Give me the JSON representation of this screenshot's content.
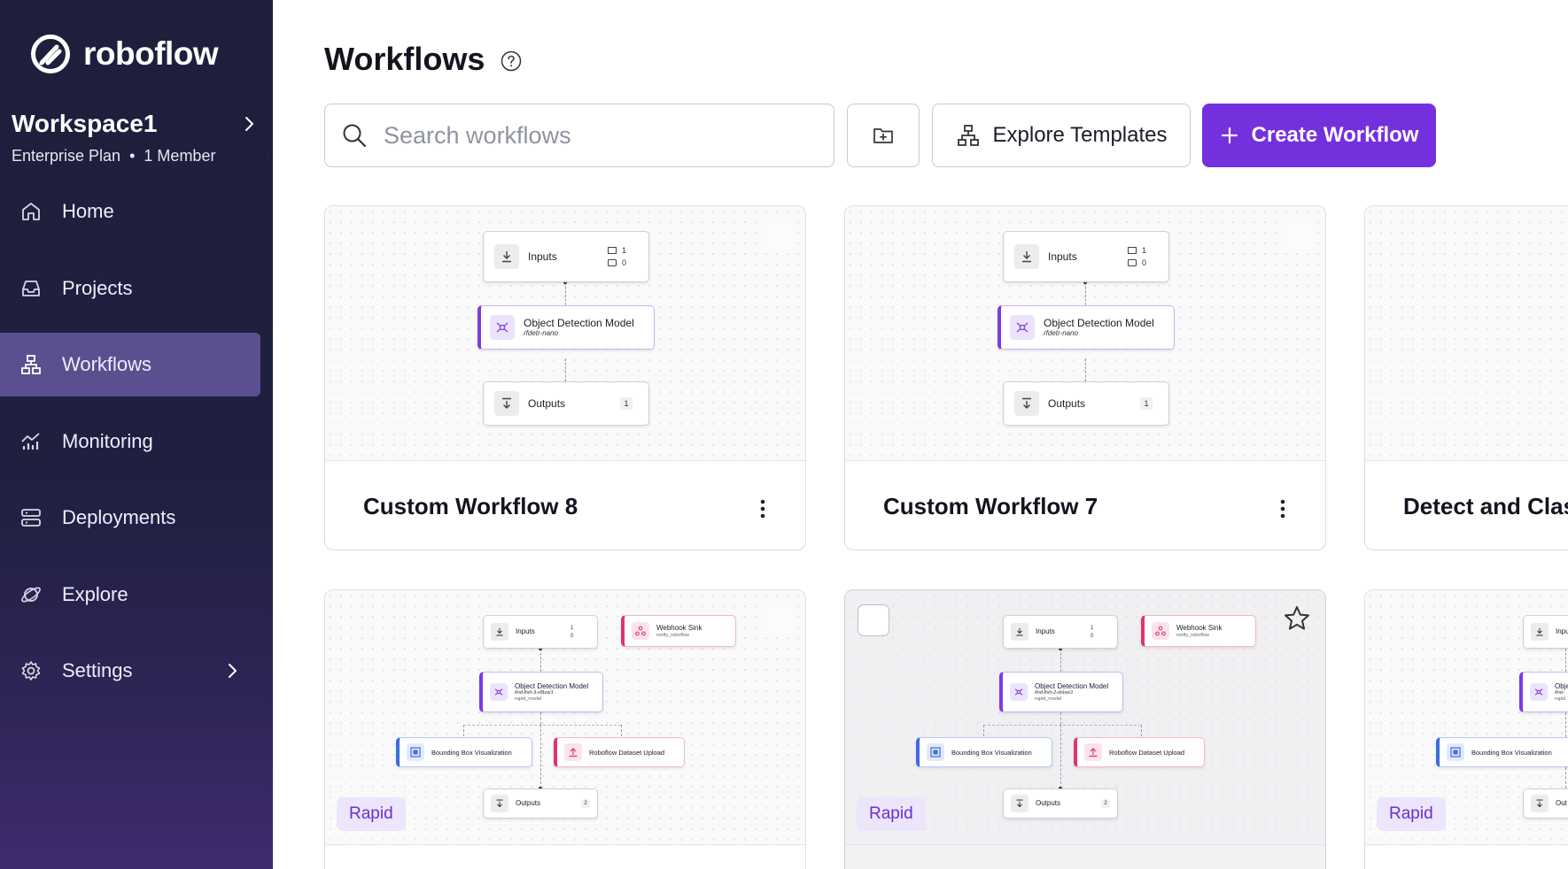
{
  "brand": {
    "name": "roboflow"
  },
  "workspace": {
    "name": "Workspace1",
    "plan": "Enterprise Plan",
    "separator": "•",
    "members": "1 Member"
  },
  "nav": [
    {
      "label": "Home",
      "icon": "home-icon"
    },
    {
      "label": "Projects",
      "icon": "inbox-icon"
    },
    {
      "label": "Workflows",
      "icon": "workflow-icon",
      "active": true
    },
    {
      "label": "Monitoring",
      "icon": "monitoring-icon"
    },
    {
      "label": "Deployments",
      "icon": "server-icon"
    },
    {
      "label": "Explore",
      "icon": "planet-icon"
    },
    {
      "label": "Settings",
      "icon": "gear-icon",
      "has_submenu": true
    }
  ],
  "page": {
    "title": "Workflows"
  },
  "search": {
    "placeholder": "Search workflows",
    "value": ""
  },
  "toolbar": {
    "explore_label": "Explore Templates",
    "create_label": "Create Workflow"
  },
  "colors": {
    "accent": "#7530de",
    "sidebar_bg": "#1e1f3b",
    "active_nav": "#5b4f8f"
  },
  "cards_row1": [
    {
      "title": "Custom Workflow 8",
      "nodes": {
        "inputs": "Inputs",
        "inputs_images": "1",
        "inputs_params": "0",
        "model": "Object Detection Model",
        "model_id": "rfdetr-nano",
        "outputs": "Outputs",
        "outputs_count": "1"
      }
    },
    {
      "title": "Custom Workflow 7",
      "nodes": {
        "inputs": "Inputs",
        "inputs_images": "1",
        "inputs_params": "0",
        "model": "Object Detection Model",
        "model_id": "rfdetr-nano",
        "outputs": "Outputs",
        "outputs_count": "1"
      }
    },
    {
      "title": "Detect and Clas"
    }
  ],
  "cards_row2": [
    {
      "badge": "Rapid",
      "nodes": {
        "inputs": "Inputs",
        "inputs_images": "1",
        "inputs_params": "0",
        "webhook": "Webhook Sink",
        "webhook_sub": "notify_roboflow",
        "model": "Object Detection Model",
        "model_id": "find-fish-3-x8tza/1",
        "model_sub": "rapid_model",
        "bbox": "Bounding Box Visualization",
        "upload": "Roboflow Dataset Upload",
        "outputs": "Outputs",
        "outputs_count": "2"
      }
    },
    {
      "badge": "Rapid",
      "nodes": {
        "inputs": "Inputs",
        "inputs_images": "1",
        "inputs_params": "0",
        "webhook": "Webhook Sink",
        "webhook_sub": "notify_roboflow",
        "model": "Object Detection Model",
        "model_id": "find-fish-2-dsbw/1",
        "model_sub": "rapid_model",
        "bbox": "Bounding Box Visualization",
        "upload": "Roboflow Dataset Upload",
        "outputs": "Outputs",
        "outputs_count": "2"
      }
    },
    {
      "badge": "Rapid",
      "nodes": {
        "inputs": "Inpu",
        "model": "Obje",
        "model_id": "find-",
        "model_sub": "rapid",
        "bbox": "Bounding Box Visualization",
        "outputs": "Out"
      }
    }
  ]
}
